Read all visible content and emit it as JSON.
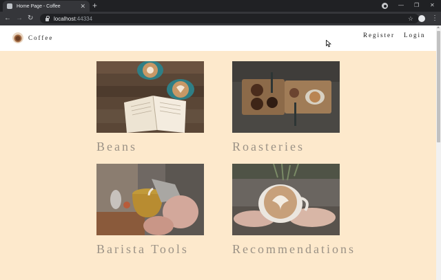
{
  "browser": {
    "tab_title": "Home Page - Coffee",
    "url_host": "localhost",
    "url_port": ":44334"
  },
  "navbar": {
    "brand": "Coffee",
    "links": [
      "Register",
      "Login"
    ]
  },
  "cards": [
    {
      "title": "Beans",
      "image": "latte-cups-and-book-photo"
    },
    {
      "title": "Roasteries",
      "image": "coffee-beans-board-photo"
    },
    {
      "title": "Barista Tools",
      "image": "milk-pouring-photo"
    },
    {
      "title": "Recommendations",
      "image": "latte-art-hands-photo"
    }
  ],
  "colors": {
    "page_background": "#fde9cc",
    "card_title": "#9b9286",
    "navbar_background": "#ffffff"
  }
}
